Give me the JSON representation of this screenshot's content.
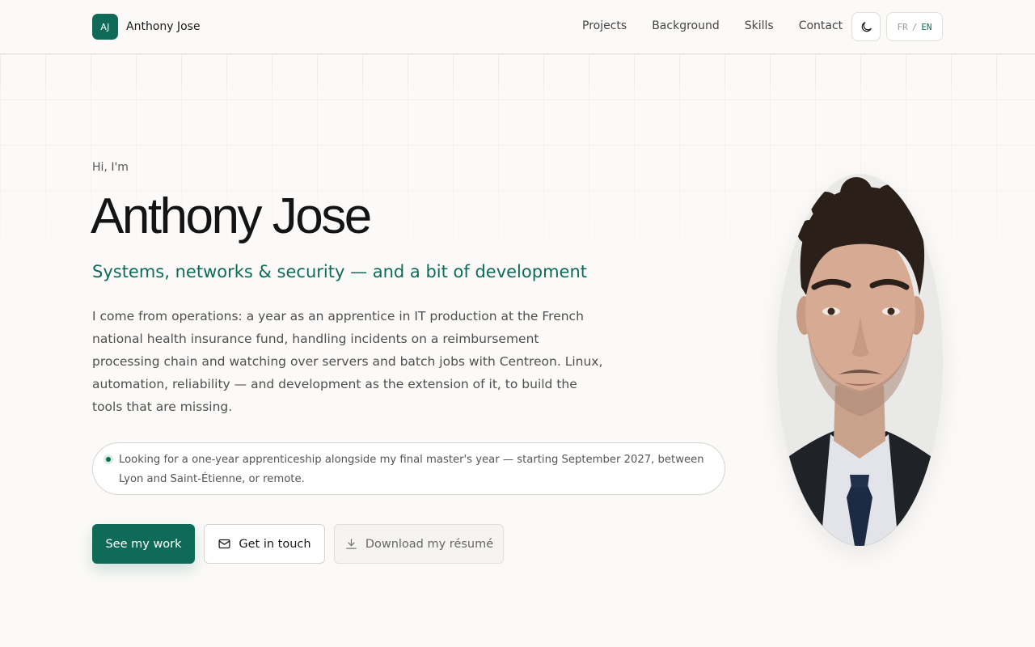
{
  "header": {
    "brand_initials": "AJ",
    "brand_name": "Anthony Jose",
    "nav": [
      "Projects",
      "Background",
      "Skills",
      "Contact"
    ],
    "lang_fr": "FR",
    "lang_sep": "/",
    "lang_en": "EN",
    "theme_icon": "moon-icon"
  },
  "hero": {
    "greeting": "Hi, I'm",
    "name": "Anthony Jose",
    "tagline": "Systems, networks & security — and a bit of development",
    "intro": "I come from operations: a year as an apprentice in IT production at the French national health insurance fund, handling incidents on a reimbursement processing chain and watching over servers and batch jobs with Centreon. Linux, automation, reliability — and development as the extension of it, to build the tools that are missing.",
    "status": "Looking for a one-year apprenticeship alongside my final master's year — starting September 2027, between Lyon and Saint-Étienne, or remote.",
    "buttons": {
      "primary": "See my work",
      "secondary": "Get in touch",
      "tertiary": "Download my résumé"
    },
    "icons": {
      "secondary": "mail-icon",
      "tertiary": "download-icon"
    }
  },
  "colors": {
    "accent": "#0f6b57",
    "background": "#fbfaf8",
    "text": "#141414"
  }
}
